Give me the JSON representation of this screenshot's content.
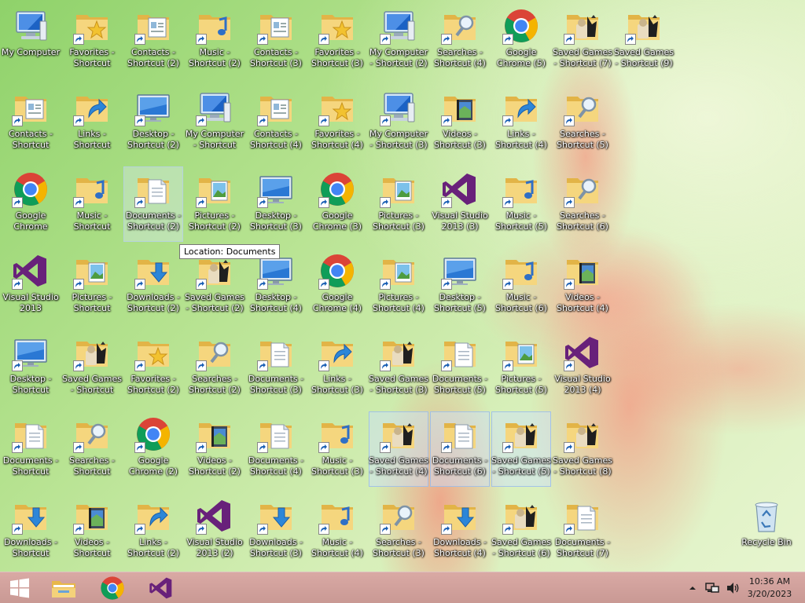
{
  "desktop": {
    "icons": [
      {
        "label": "My Computer",
        "type": "computer",
        "shortcut": false
      },
      {
        "label": "Favorites - Shortcut",
        "type": "favorites",
        "shortcut": true
      },
      {
        "label": "Contacts - Shortcut (2)",
        "type": "contacts",
        "shortcut": true
      },
      {
        "label": "Music - Shortcut (2)",
        "type": "music",
        "shortcut": true
      },
      {
        "label": "Contacts - Shortcut (3)",
        "type": "contacts",
        "shortcut": true
      },
      {
        "label": "Favorites - Shortcut (3)",
        "type": "favorites",
        "shortcut": true
      },
      {
        "label": "My Computer - Shortcut (2)",
        "type": "computer",
        "shortcut": true
      },
      {
        "label": "Searches - Shortcut (4)",
        "type": "searches",
        "shortcut": true
      },
      {
        "label": "Google Chrome (5)",
        "type": "chrome",
        "shortcut": true
      },
      {
        "label": "Saved Games - Shortcut (7)",
        "type": "games",
        "shortcut": true
      },
      {
        "label": "Saved Games - Shortcut (9)",
        "type": "games",
        "shortcut": true
      },
      {
        "label": "Contacts - Shortcut",
        "type": "contacts",
        "shortcut": true
      },
      {
        "label": "Links - Shortcut",
        "type": "links",
        "shortcut": true
      },
      {
        "label": "Desktop - Shortcut (2)",
        "type": "desktop",
        "shortcut": true
      },
      {
        "label": "My Computer - Shortcut",
        "type": "computer",
        "shortcut": true
      },
      {
        "label": "Contacts - Shortcut (4)",
        "type": "contacts",
        "shortcut": true
      },
      {
        "label": "Favorites - Shortcut (4)",
        "type": "favorites",
        "shortcut": true
      },
      {
        "label": "My Computer - Shortcut (3)",
        "type": "computer",
        "shortcut": true
      },
      {
        "label": "Videos - Shortcut (3)",
        "type": "videos",
        "shortcut": true
      },
      {
        "label": "Links - Shortcut (4)",
        "type": "links",
        "shortcut": true
      },
      {
        "label": "Searches - Shortcut (5)",
        "type": "searches",
        "shortcut": true
      },
      {
        "label": "Google Chrome",
        "type": "chrome",
        "shortcut": true
      },
      {
        "label": "Music - Shortcut",
        "type": "music",
        "shortcut": true
      },
      {
        "label": "Documents - Shortcut (2)",
        "type": "documents",
        "shortcut": true,
        "state": "hover"
      },
      {
        "label": "Pictures - Shortcut (2)",
        "type": "pictures",
        "shortcut": true
      },
      {
        "label": "Desktop - Shortcut (3)",
        "type": "desktop",
        "shortcut": true
      },
      {
        "label": "Google Chrome (3)",
        "type": "chrome",
        "shortcut": true
      },
      {
        "label": "Pictures - Shortcut (3)",
        "type": "pictures",
        "shortcut": true
      },
      {
        "label": "Visual Studio 2013 (3)",
        "type": "vs",
        "shortcut": true
      },
      {
        "label": "Music - Shortcut (5)",
        "type": "music",
        "shortcut": true
      },
      {
        "label": "Searches - Shortcut (6)",
        "type": "searches",
        "shortcut": true
      },
      {
        "label": "Visual Studio 2013",
        "type": "vs",
        "shortcut": true
      },
      {
        "label": "Pictures - Shortcut",
        "type": "pictures",
        "shortcut": true
      },
      {
        "label": "Downloads - Shortcut (2)",
        "type": "downloads",
        "shortcut": true
      },
      {
        "label": "Saved Games - Shortcut (2)",
        "type": "games",
        "shortcut": true
      },
      {
        "label": "Desktop - Shortcut (4)",
        "type": "desktop",
        "shortcut": true
      },
      {
        "label": "Google Chrome (4)",
        "type": "chrome",
        "shortcut": true
      },
      {
        "label": "Pictures - Shortcut (4)",
        "type": "pictures",
        "shortcut": true
      },
      {
        "label": "Desktop - Shortcut (5)",
        "type": "desktop",
        "shortcut": true
      },
      {
        "label": "Music - Shortcut (6)",
        "type": "music",
        "shortcut": true
      },
      {
        "label": "Videos - Shortcut (4)",
        "type": "videos",
        "shortcut": true
      },
      {
        "label": "Desktop - Shortcut",
        "type": "desktop",
        "shortcut": true
      },
      {
        "label": "Saved Games - Shortcut",
        "type": "games",
        "shortcut": true
      },
      {
        "label": "Favorites - Shortcut (2)",
        "type": "favorites",
        "shortcut": true
      },
      {
        "label": "Searches - Shortcut (2)",
        "type": "searches",
        "shortcut": true
      },
      {
        "label": "Documents - Shortcut (3)",
        "type": "documents",
        "shortcut": true
      },
      {
        "label": "Links - Shortcut (3)",
        "type": "links",
        "shortcut": true
      },
      {
        "label": "Saved Games - Shortcut (3)",
        "type": "games",
        "shortcut": true
      },
      {
        "label": "Documents - Shortcut (5)",
        "type": "documents",
        "shortcut": true
      },
      {
        "label": "Pictures - Shortcut (5)",
        "type": "pictures",
        "shortcut": true
      },
      {
        "label": "Visual Studio 2013 (4)",
        "type": "vs",
        "shortcut": true
      },
      {
        "label": "Documents - Shortcut",
        "type": "documents",
        "shortcut": true
      },
      {
        "label": "Searches - Shortcut",
        "type": "searches",
        "shortcut": true
      },
      {
        "label": "Google Chrome (2)",
        "type": "chrome",
        "shortcut": true
      },
      {
        "label": "Videos - Shortcut (2)",
        "type": "videos",
        "shortcut": true
      },
      {
        "label": "Documents - Shortcut (4)",
        "type": "documents",
        "shortcut": true
      },
      {
        "label": "Music - Shortcut (3)",
        "type": "music",
        "shortcut": true
      },
      {
        "label": "Saved Games - Shortcut (4)",
        "type": "games",
        "shortcut": true,
        "state": "selected"
      },
      {
        "label": "Documents - Shortcut (6)",
        "type": "documents",
        "shortcut": true,
        "state": "selected"
      },
      {
        "label": "Saved Games - Shortcut (5)",
        "type": "games",
        "shortcut": true,
        "state": "selected"
      },
      {
        "label": "Saved Games - Shortcut (8)",
        "type": "games",
        "shortcut": true
      },
      {
        "label": "Downloads - Shortcut",
        "type": "downloads",
        "shortcut": true
      },
      {
        "label": "Videos - Shortcut",
        "type": "videos",
        "shortcut": true
      },
      {
        "label": "Links - Shortcut (2)",
        "type": "links",
        "shortcut": true
      },
      {
        "label": "Visual Studio 2013 (2)",
        "type": "vs",
        "shortcut": true
      },
      {
        "label": "Downloads - Shortcut (3)",
        "type": "downloads",
        "shortcut": true
      },
      {
        "label": "Music - Shortcut (4)",
        "type": "music",
        "shortcut": true
      },
      {
        "label": "Searches - Shortcut (3)",
        "type": "searches",
        "shortcut": true
      },
      {
        "label": "Downloads - Shortcut (4)",
        "type": "downloads",
        "shortcut": true
      },
      {
        "label": "Saved Games - Shortcut (6)",
        "type": "games",
        "shortcut": true
      },
      {
        "label": "Documents - Shortcut (7)",
        "type": "documents",
        "shortcut": true
      },
      {
        "label": "Recycle Bin",
        "type": "recycle",
        "shortcut": false
      }
    ],
    "tooltip": "Location: Documents"
  },
  "taskbar": {
    "pinned": [
      {
        "name": "start",
        "icon": "windows-logo-icon"
      },
      {
        "name": "file-explorer",
        "icon": "folder-icon"
      },
      {
        "name": "google-chrome",
        "icon": "chrome-icon"
      },
      {
        "name": "visual-studio",
        "icon": "visual-studio-icon"
      }
    ],
    "clock": {
      "time": "10:36 AM",
      "date": "3/20/2023"
    }
  },
  "colors": {
    "taskbar": "#cf9f9a",
    "vs_purple": "#68217a",
    "folder": "#f3d27a"
  }
}
